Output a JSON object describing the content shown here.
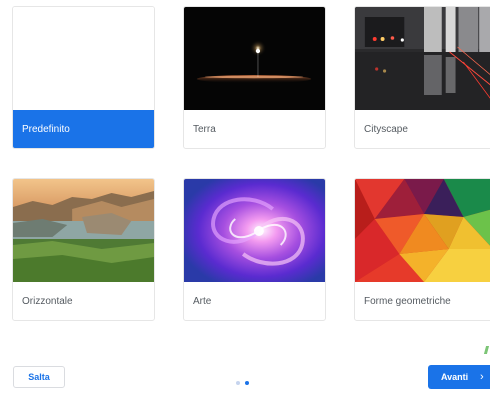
{
  "wallpapers": {
    "items": [
      {
        "label": "Predefinito",
        "selected": true
      },
      {
        "label": "Terra",
        "selected": false
      },
      {
        "label": "Cityscape",
        "selected": false
      },
      {
        "label": "Orizzontale",
        "selected": false
      },
      {
        "label": "Arte",
        "selected": false
      },
      {
        "label": "Forme geometriche",
        "selected": false
      }
    ]
  },
  "footer": {
    "skip_label": "Salta",
    "next_label": "Avanti",
    "next_icon": "chevron-right-icon",
    "pagination": {
      "total": 2,
      "active": 2
    }
  },
  "colors": {
    "accent": "#1a73e8",
    "dot_inactive": "#c6d4ee"
  }
}
